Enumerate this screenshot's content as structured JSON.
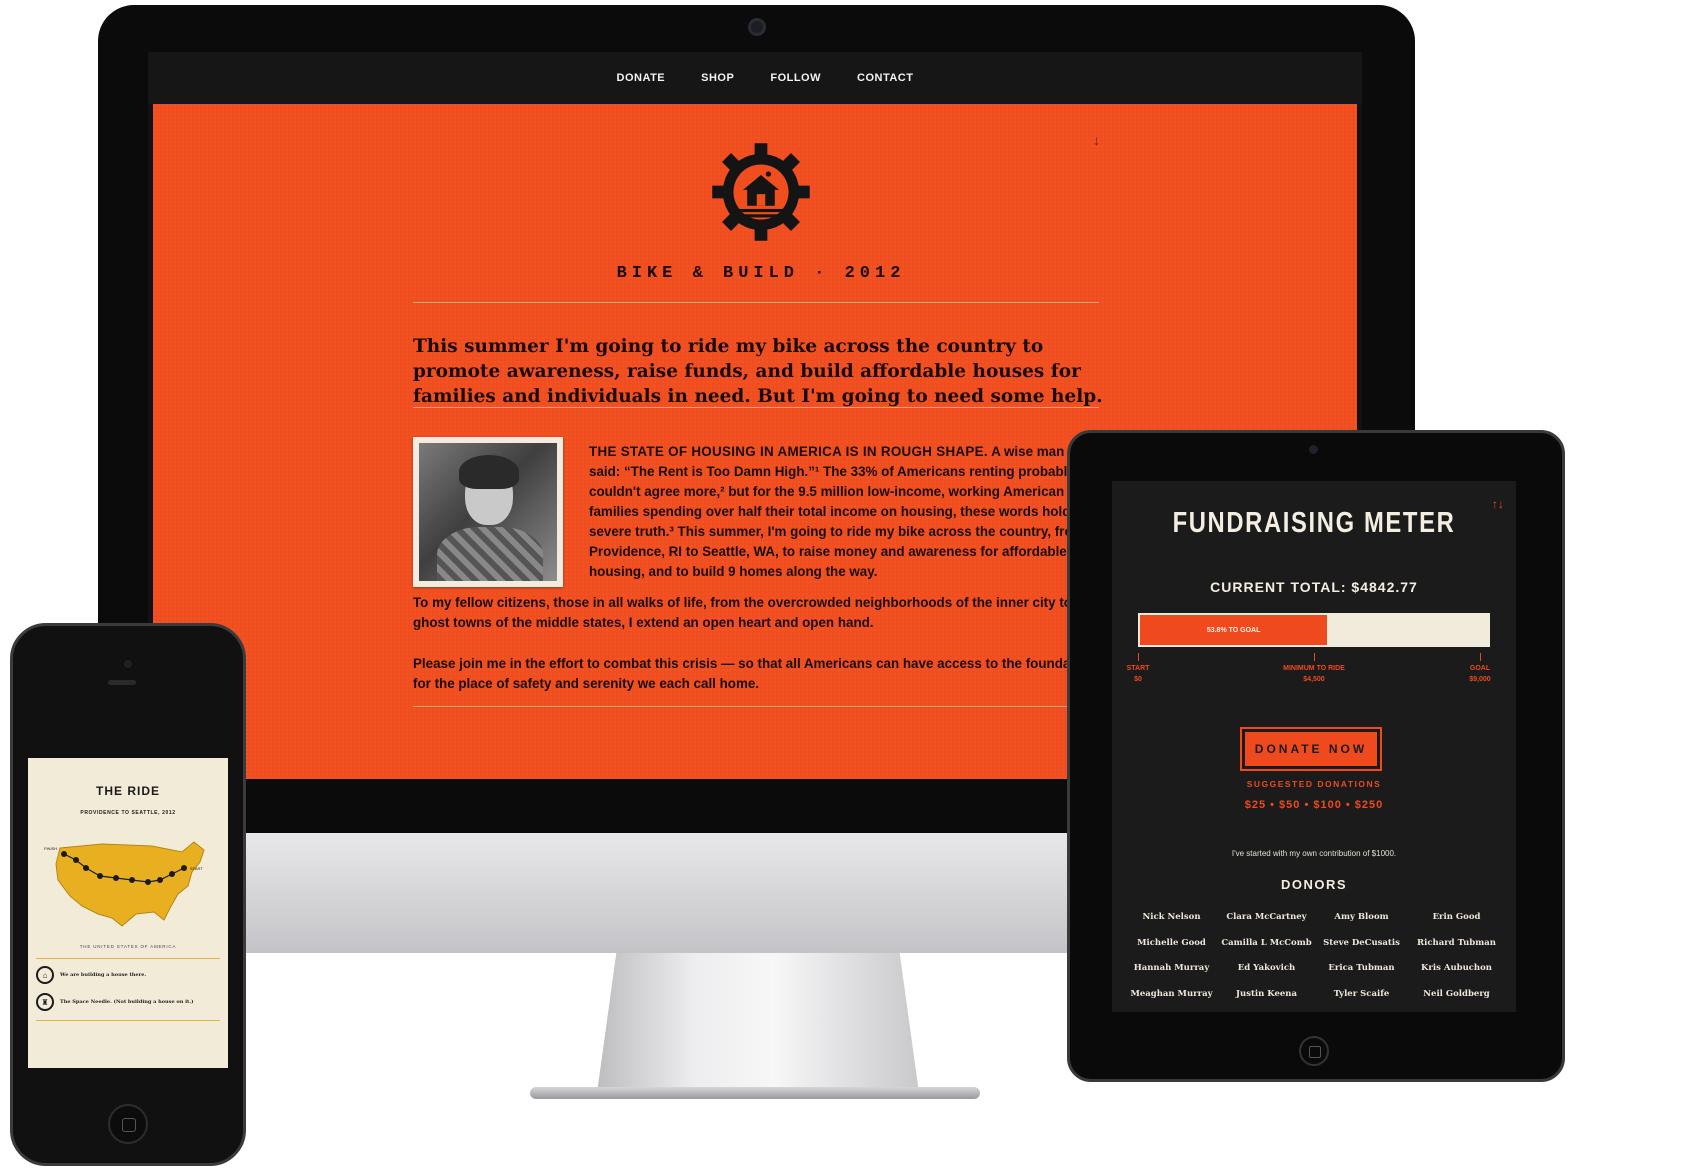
{
  "desktop": {
    "nav": [
      "DONATE",
      "SHOP",
      "FOLLOW",
      "CONTACT"
    ],
    "scroll_arrow": "↓",
    "site_title": "BIKE & BUILD · 2012",
    "intro": "This summer I'm going to ride my bike across the country to promote awareness, raise funds, and build affordable houses for families and individuals in need. But I'm going to need some help.",
    "body_lead": "THE STATE OF HOUSING IN AMERICA IS IN ROUGH SHAPE.",
    "body_text": "A wise man once said: “The Rent is Too Damn High.”¹ The 33% of Americans renting probably couldn't agree more,² but for the 9.5 million low-income, working American families spending over half their total income on housing, these words hold a severe truth.³ This summer, I'm going to ride my bike across the country, from Providence, RI to Seattle, WA, to raise money and awareness for affordable housing, and to build 9 homes along the way.",
    "para_citizens": "To my fellow citizens, those in all walks of life, from the overcrowded neighborhoods of the inner city to the ghost towns of the middle states, I extend an open heart and open hand.",
    "para_join": "Please join me in the effort to combat this crisis — so that all Americans can have access to the foundation for the place of safety and serenity we each call home.",
    "accent_color": "#f04e1f"
  },
  "tablet": {
    "arrows": "↑↓",
    "title": "FUNDRAISING METER",
    "current_total": "CURRENT TOTAL: $4842.77",
    "progress_fraction": 0.538,
    "progress_label": "53.8% TO GOAL",
    "markers": [
      {
        "label": "START",
        "value": "$0",
        "frac": 0
      },
      {
        "label": "MINIMUM TO RIDE",
        "value": "$4,500",
        "frac": 0.5
      },
      {
        "label": "GOAL",
        "value": "$9,000",
        "frac": 1
      }
    ],
    "donate_button": "DONATE NOW",
    "suggested_label": "SUGGESTED DONATIONS",
    "suggested_amounts": "$25 • $50 • $100 • $250",
    "contribution_note": "I've started with my own contribution of $1000.",
    "donors_title": "DONORS",
    "donors": [
      "Nick Nelson",
      "Clara McCartney",
      "Amy Bloom",
      "Erin Good",
      "Michelle Good",
      "Camilla L McComb",
      "Steve DeCusatis",
      "Richard Tubman",
      "Hannah Murray",
      "Ed Yakovich",
      "Erica Tubman",
      "Kris Aubuchon",
      "Meaghan Murray",
      "Justin Keena",
      "Tyler Scaife",
      "Neil Goldberg"
    ]
  },
  "phone": {
    "title": "THE RIDE",
    "subtitle": "PROVIDENCE TO SEATTLE, 2012",
    "map_labels": {
      "finish": "FINISH",
      "start": "START"
    },
    "country_label": "THE UNITED STATES OF AMERICA",
    "legend": [
      {
        "icon": "house-icon",
        "text": "We are building a house there."
      },
      {
        "icon": "space-needle-icon",
        "text": "The Space Needle. (Not building a house on it.)"
      }
    ],
    "map_color": "#e8b020"
  }
}
